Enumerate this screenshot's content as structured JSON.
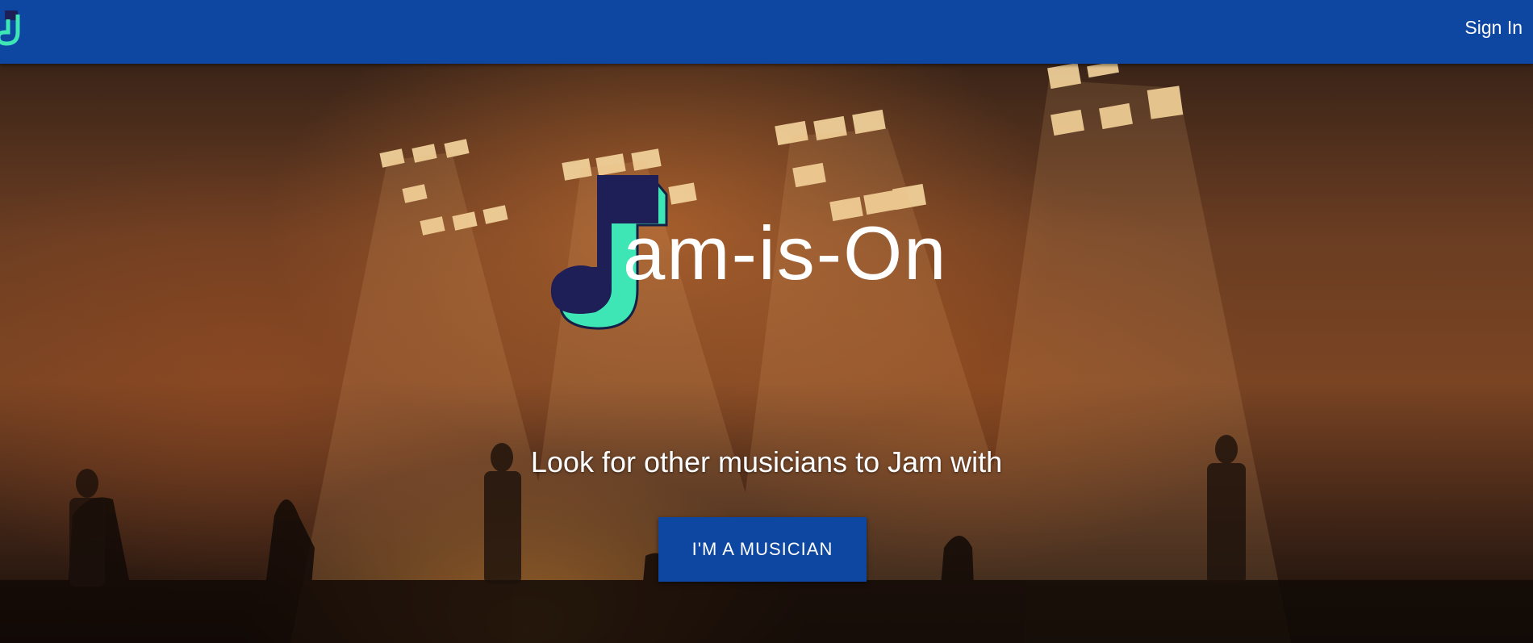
{
  "navbar": {
    "logo_icon": "music-note-logo-icon",
    "sign_in_label": "Sign In",
    "background_color": "#0e47a1"
  },
  "hero": {
    "background": "concert stage photo",
    "brand_icon": "music-note-logo-icon",
    "brand_name": "am-is-On",
    "tagline": "Look for other musicians to Jam with",
    "cta_label": "I'M A MUSICIAN"
  },
  "colors": {
    "primary": "#0e47a1",
    "logo_dark": "#1e1f57",
    "logo_mint": "#3ee6b6",
    "text": "#ffffff"
  }
}
